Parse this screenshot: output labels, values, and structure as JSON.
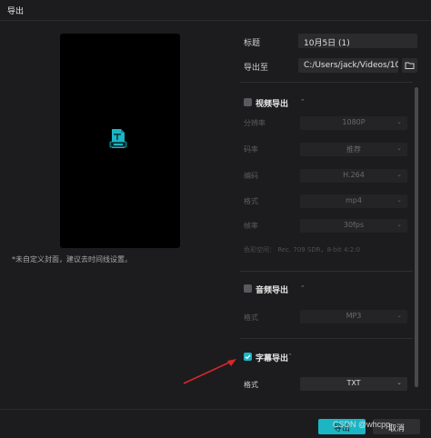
{
  "window": {
    "title": "导出"
  },
  "preview": {
    "note": "*未自定义封面，建议去时间线设置。"
  },
  "title_field": {
    "label": "标题",
    "value": "10月5日 (1)"
  },
  "export_to": {
    "label": "导出至",
    "value": "C:/Users/jack/Videos/10..."
  },
  "video_export": {
    "heading": "视频导出",
    "checked": false,
    "rows": [
      {
        "label": "分辨率",
        "value": "1080P"
      },
      {
        "label": "码率",
        "value": "推荐"
      },
      {
        "label": "编码",
        "value": "H.264"
      },
      {
        "label": "格式",
        "value": "mp4"
      },
      {
        "label": "帧率",
        "value": "30fps"
      }
    ],
    "info": "色彩空间：  Rec. 709 SDR，8-bit 4:2:0"
  },
  "audio_export": {
    "heading": "音频导出",
    "checked": false,
    "format_label": "格式",
    "format_value": "MP3"
  },
  "subtitle_export": {
    "heading": "字幕导出",
    "checked": true,
    "format_label": "格式",
    "format_value": "TXT"
  },
  "footer": {
    "export_label": "导出",
    "cancel_label": "取消",
    "watermark": "CSDN @whcpp"
  },
  "colors": {
    "accent": "#1bb5c4",
    "background": "#1c1c1e",
    "annotation_arrow": "#d8262b"
  },
  "icons": {
    "file": "file-icon",
    "folder": "folder-icon",
    "checkbox": "checkbox-icon",
    "chevron": "chevron-down-icon"
  }
}
